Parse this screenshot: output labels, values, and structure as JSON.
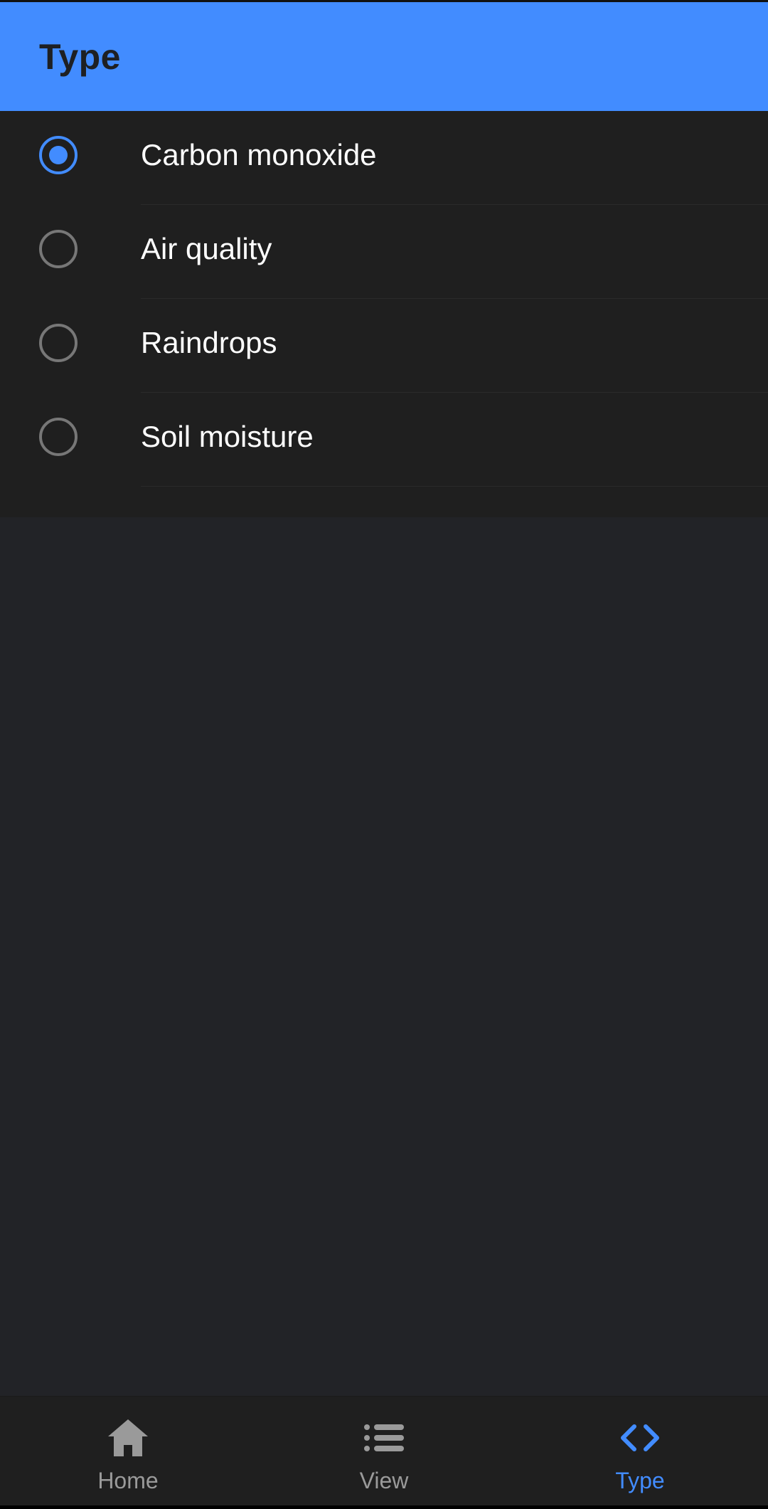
{
  "app_bar": {
    "title": "Type"
  },
  "radio_list": {
    "selected_index": 0,
    "items": [
      {
        "label": "Carbon monoxide",
        "checked": true
      },
      {
        "label": "Air quality",
        "checked": false
      },
      {
        "label": "Raindrops",
        "checked": false
      },
      {
        "label": "Soil moisture",
        "checked": false
      }
    ]
  },
  "bottom_nav": {
    "items": [
      {
        "label": "Home",
        "icon": "home-icon",
        "active": false
      },
      {
        "label": "View",
        "icon": "list-icon",
        "active": false
      },
      {
        "label": "Type",
        "icon": "code-icon",
        "active": true
      }
    ]
  },
  "colors": {
    "accent": "#428cff",
    "app_bar_text": "#1e2023",
    "list_background": "#1f1f1f",
    "page_background": "#222327",
    "inactive_nav": "#9a9a9a",
    "unchecked_radio": "#777777"
  }
}
